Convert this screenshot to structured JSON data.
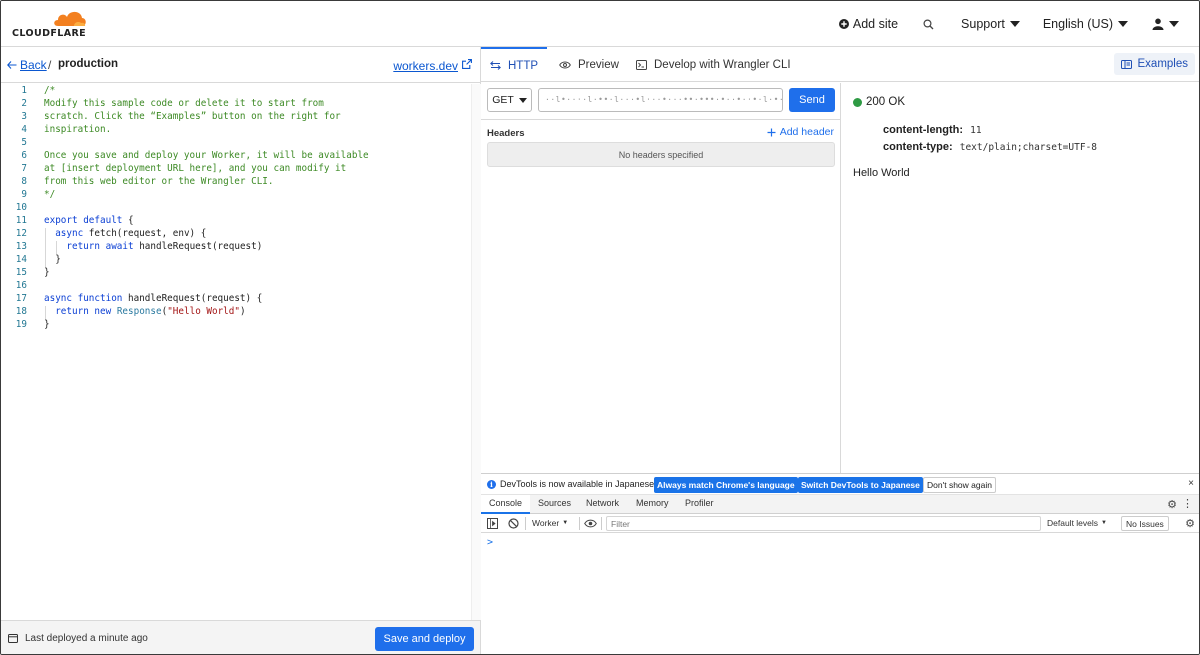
{
  "topbar": {
    "logo_text": "CLOUDFLARE",
    "add_site": "Add site",
    "support": "Support",
    "language": "English (US)"
  },
  "left": {
    "back": "Back",
    "separator": "/",
    "worker_name": "production",
    "workers_dev": "workers.dev",
    "status": "Last deployed a minute ago",
    "save_deploy": "Save and deploy"
  },
  "code_lines": [
    "/*",
    "Modify this sample code or delete it to start from",
    "scratch. Click the “Examples” button on the right for",
    "inspiration.",
    "",
    "Once you save and deploy your Worker, it will be available",
    "at [insert deployment URL here], and you can modify it",
    "from this web editor or the Wrangler CLI.",
    "*/",
    "",
    "export default {",
    "  async fetch(request, env) {",
    "    return await handleRequest(request)",
    "  }",
    "}",
    "",
    "async function handleRequest(request) {",
    "  return new Response(\"Hello World\")",
    "}"
  ],
  "tabs": {
    "http": "HTTP",
    "preview": "Preview",
    "wrangler": "Develop with Wrangler CLI",
    "examples": "Examples"
  },
  "request": {
    "method": "GET",
    "url": "··l•··⋅·l·••·l···•l⋅··•···••·•••·•··•·⋅•·l·•·",
    "send": "Send",
    "headers_label": "Headers",
    "add_header": "Add header",
    "no_headers": "No headers specified"
  },
  "response": {
    "status": "200 OK",
    "headers": [
      {
        "key": "content-length:",
        "value": "11"
      },
      {
        "key": "content-type:",
        "value": "text/plain;charset=UTF-8"
      }
    ],
    "body": "Hello World"
  },
  "devtools": {
    "banner_msg": "DevTools is now available in Japanese!",
    "btn_match": "Always match Chrome's language",
    "btn_switch": "Switch DevTools to Japanese",
    "btn_dont_show": "Don't show again",
    "close": "×",
    "tabs": [
      "Console",
      "Sources",
      "Network",
      "Memory",
      "Profiler"
    ],
    "context": "Worker",
    "filter_placeholder": "Filter",
    "levels": "Default levels",
    "issues": "No Issues",
    "prompt": ">"
  },
  "colors": {
    "accent": "#1f6feb",
    "status_ok": "#2e9a44",
    "logo_orange": "#f38020"
  }
}
